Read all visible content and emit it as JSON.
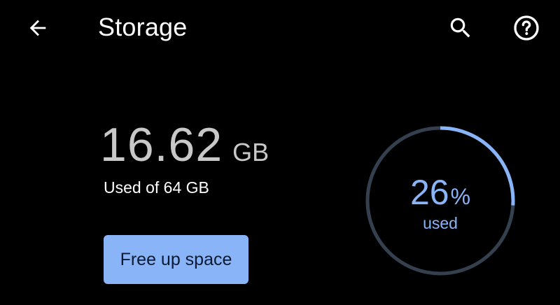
{
  "app_bar": {
    "title": "Storage",
    "back_icon": "arrow-back-icon",
    "search_icon": "search-icon",
    "help_icon": "help-circle-icon"
  },
  "storage": {
    "used_value": "16.62",
    "used_unit": "GB",
    "used_caption": "Used of 64 GB",
    "used_fraction": 0.26,
    "percent_value": "26",
    "percent_sign": "%",
    "percent_label": "used"
  },
  "actions": {
    "free_up_label": "Free up space"
  },
  "colors": {
    "background": "#000000",
    "accent": "#8ab4f8",
    "ring_track": "#35404f",
    "text_primary": "#ffffff",
    "text_secondary": "#c8c8c8"
  }
}
